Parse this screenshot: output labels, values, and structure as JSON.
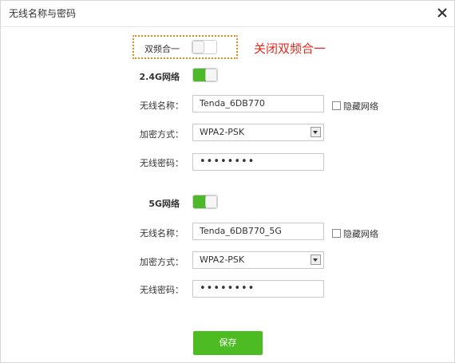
{
  "dialog": {
    "title": "无线名称与密码"
  },
  "dual_band": {
    "label": "双频合一",
    "enabled": false,
    "annotation": "关闭双频合一"
  },
  "band_24": {
    "section_label": "2.4G网络",
    "enabled": true,
    "ssid_label": "无线名称：",
    "ssid_value": "Tenda_6DB770",
    "hide_label": "隐藏网络",
    "hidden": false,
    "security_label": "加密方式：",
    "security_value": "WPA2-PSK",
    "password_label": "无线密码：",
    "password_value": "••••••••"
  },
  "band_5": {
    "section_label": "5G网络",
    "enabled": true,
    "ssid_label": "无线名称：",
    "ssid_value": "Tenda_6DB770_5G",
    "hide_label": "隐藏网络",
    "hidden": false,
    "security_label": "加密方式：",
    "security_value": "WPA2-PSK",
    "password_label": "无线密码：",
    "password_value": "••••••••"
  },
  "actions": {
    "save_label": "保存"
  },
  "colors": {
    "accent": "#4cbc22",
    "annotation": "#e4281b",
    "highlight_border": "#e8891c"
  },
  "icons": {
    "close": "close-icon",
    "dropdown": "chevron-down-icon"
  }
}
